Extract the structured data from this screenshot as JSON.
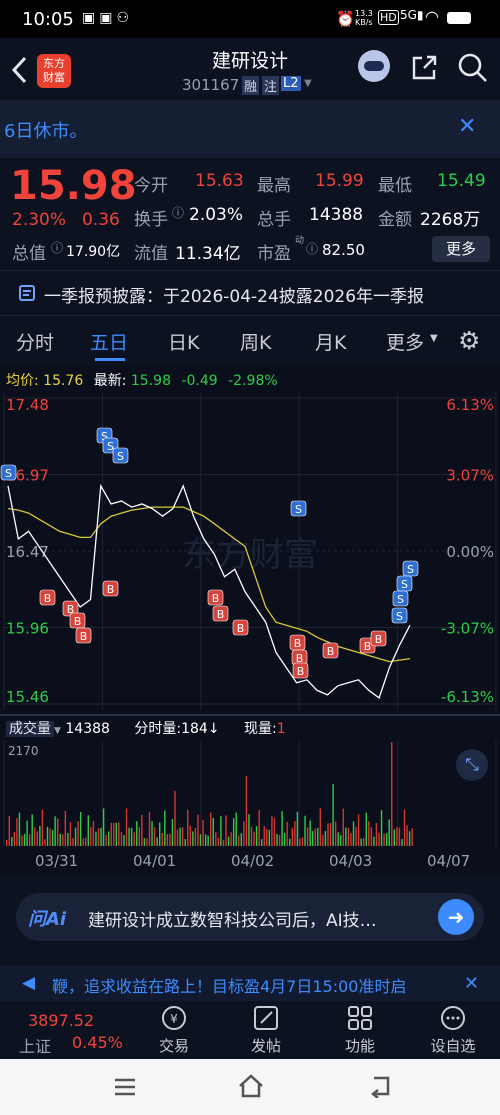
{
  "status": {
    "time": "10:05",
    "net_speed": "13.3\nKB/s",
    "battery": "battery"
  },
  "nav": {
    "title": "建研设计",
    "code": "301167",
    "tag_rong": "融",
    "tag_zhu": "注",
    "tag_l2": "L2"
  },
  "notice": {
    "text": "6日休市。"
  },
  "quote": {
    "price": "15.98",
    "change_pct": "2.30%",
    "change": "0.36",
    "open_label": "今开",
    "open": "15.63",
    "high_label": "最高",
    "high": "15.99",
    "low_label": "最低",
    "low": "15.49",
    "turnover_label": "换手",
    "turnover": "2.03%",
    "volume_label": "总手",
    "volume": "14388",
    "amount_label": "金额",
    "amount": "2268万",
    "mktcap_label": "总值",
    "mktcap": "17.90亿",
    "float_label": "流值",
    "float": "11.34亿",
    "pe_label": "市盈",
    "pe_sup": "动",
    "pe": "82.50",
    "more_button": "更多"
  },
  "report": {
    "text": "一季报预披露：于2026-04-24披露2026年一季报"
  },
  "tabs": [
    "分时",
    "五日",
    "日K",
    "周K",
    "月K",
    "更多"
  ],
  "active_tab": "五日",
  "chart_header": {
    "avg_label": "均价:",
    "avg": "15.76",
    "latest_label": "最新:",
    "latest": "15.98",
    "diff": "-0.49",
    "pct": "-2.98%"
  },
  "y_left": [
    "17.48",
    "16.97",
    "16.47",
    "15.96",
    "15.46"
  ],
  "y_right": [
    "6.13%",
    "3.07%",
    "0.00%",
    "-3.07%",
    "-6.13%"
  ],
  "volume_header": {
    "label": "成交量",
    "value": "14388",
    "minute_label": "分时量:",
    "minute_value": "184",
    "minute_arrow": "↓",
    "now_label": "现量:",
    "now_value": "1"
  },
  "volume_max": "2170",
  "x_dates": [
    "03/31",
    "04/01",
    "04/02",
    "04/03",
    "04/07"
  ],
  "watermark": "东方财富",
  "ai": {
    "logo": "问Ai",
    "text": "建研设计成立数智科技公司后，AI技…"
  },
  "ticker": {
    "text": "鞭，追求收益在路上！目标盈4月7日15:00准时启"
  },
  "bottom": {
    "index_value": "3897.52",
    "index_name": "上证",
    "index_pct": "0.45%",
    "items": [
      "交易",
      "发帖",
      "功能",
      "设自选"
    ]
  },
  "chart_data": {
    "type": "line",
    "title": "",
    "x_categories": [
      "03/31",
      "04/01",
      "04/02",
      "04/03",
      "04/07"
    ],
    "y_range": [
      15.46,
      17.48
    ],
    "pct_range": [
      -6.13,
      6.13
    ],
    "prev_close": 16.47,
    "series": [
      {
        "name": "最新",
        "values": [
          16.9,
          16.55,
          16.6,
          16.5,
          16.4,
          16.3,
          16.2,
          16.1,
          16.15,
          16.9,
          16.78,
          16.8,
          16.76,
          16.78,
          16.75,
          16.7,
          16.75,
          16.9,
          16.7,
          16.55,
          16.45,
          16.3,
          16.35,
          16.2,
          16.1,
          16.0,
          15.8,
          15.7,
          15.6,
          15.62,
          15.55,
          15.52,
          15.58,
          15.6,
          15.62,
          15.55,
          15.5,
          15.7,
          15.85,
          15.98
        ]
      },
      {
        "name": "均价",
        "values": [
          16.75,
          16.74,
          16.72,
          16.68,
          16.64,
          16.6,
          16.58,
          16.56,
          16.56,
          16.65,
          16.7,
          16.72,
          16.74,
          16.75,
          16.76,
          16.76,
          16.76,
          16.76,
          16.73,
          16.7,
          16.65,
          16.6,
          16.55,
          16.5,
          16.3,
          16.1,
          16.0,
          15.98,
          15.96,
          15.94,
          15.9,
          15.87,
          15.84,
          15.82,
          15.8,
          15.78,
          15.76,
          15.74,
          15.75,
          15.76
        ]
      }
    ],
    "volume_max": 2170
  }
}
